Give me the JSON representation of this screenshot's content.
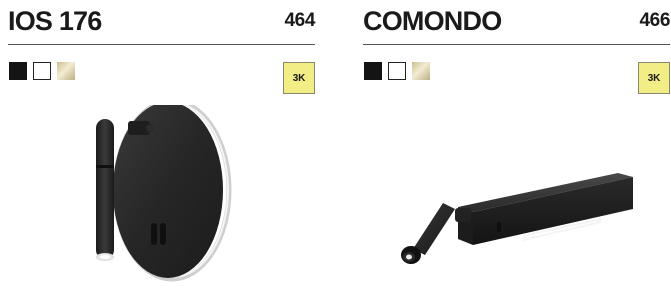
{
  "products": [
    {
      "name": "IOS 176",
      "page": "464",
      "color_options": [
        {
          "name": "black",
          "color": "#141414"
        },
        {
          "name": "white",
          "color": "#ffffff"
        },
        {
          "name": "gold",
          "color": "#d9cfa6"
        }
      ],
      "cct_badge": "3K",
      "image_icon": "round-wall-reading-lamp-icon"
    },
    {
      "name": "COMONDO",
      "page": "466",
      "color_options": [
        {
          "name": "black",
          "color": "#141414"
        },
        {
          "name": "white",
          "color": "#ffffff"
        },
        {
          "name": "gold",
          "color": "#d9cfa6"
        }
      ],
      "cct_badge": "3K",
      "image_icon": "bar-wall-reading-lamp-icon"
    }
  ],
  "colors": {
    "badge_background": "#f2ed84",
    "rule": "#555555",
    "text": "#1a1a1a"
  }
}
